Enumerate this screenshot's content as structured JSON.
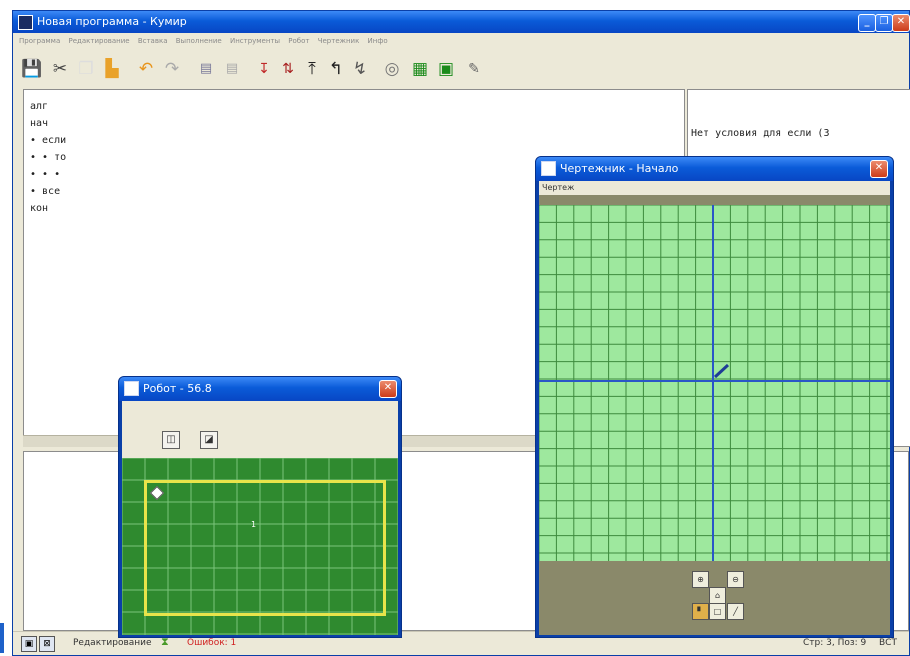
{
  "main_window": {
    "title": "Новая программа - Кумир",
    "menu": [
      "Программа",
      "Редактирование",
      "Вставка",
      "Выполнение",
      "Инструменты",
      "Робот",
      "Чертежник",
      "Инфо"
    ],
    "toolbar_icons": [
      "save-icon",
      "cut-icon",
      "copy-icon",
      "paste-icon",
      "undo-icon",
      "redo-icon",
      "indent-icon",
      "unindent-icon",
      "step-into-icon",
      "step-over-icon",
      "step-out-icon",
      "run-icon",
      "step-icon",
      "stop-icon",
      "robot-grid-icon",
      "drawer-icon",
      "pencil-icon"
    ]
  },
  "editor": {
    "lines": [
      "алг",
      "нач",
      "• если",
      "• • то",
      "• • •",
      "• все",
      "кон"
    ]
  },
  "messages": {
    "text": "Нет условия для если  (3"
  },
  "statusbar": {
    "mode": "Редактирование",
    "errors": "Ошибок: 1",
    "position": "Стр: 3, Поз: 9",
    "insert": "ВСТ"
  },
  "robot_window": {
    "title": "Робот - 56.8",
    "field_label": "1",
    "colors": {
      "field": "#2f8a2f",
      "wall": "#e8e44a",
      "grid": "#7bc47b"
    }
  },
  "drawer_window": {
    "title": "Чертежник - Начало",
    "menu": "Чертеж",
    "colors": {
      "canvas": "#9ee89e",
      "grid": "#3d8a3d",
      "axis": "#2a55c8",
      "pen": "#1e3c96"
    }
  }
}
